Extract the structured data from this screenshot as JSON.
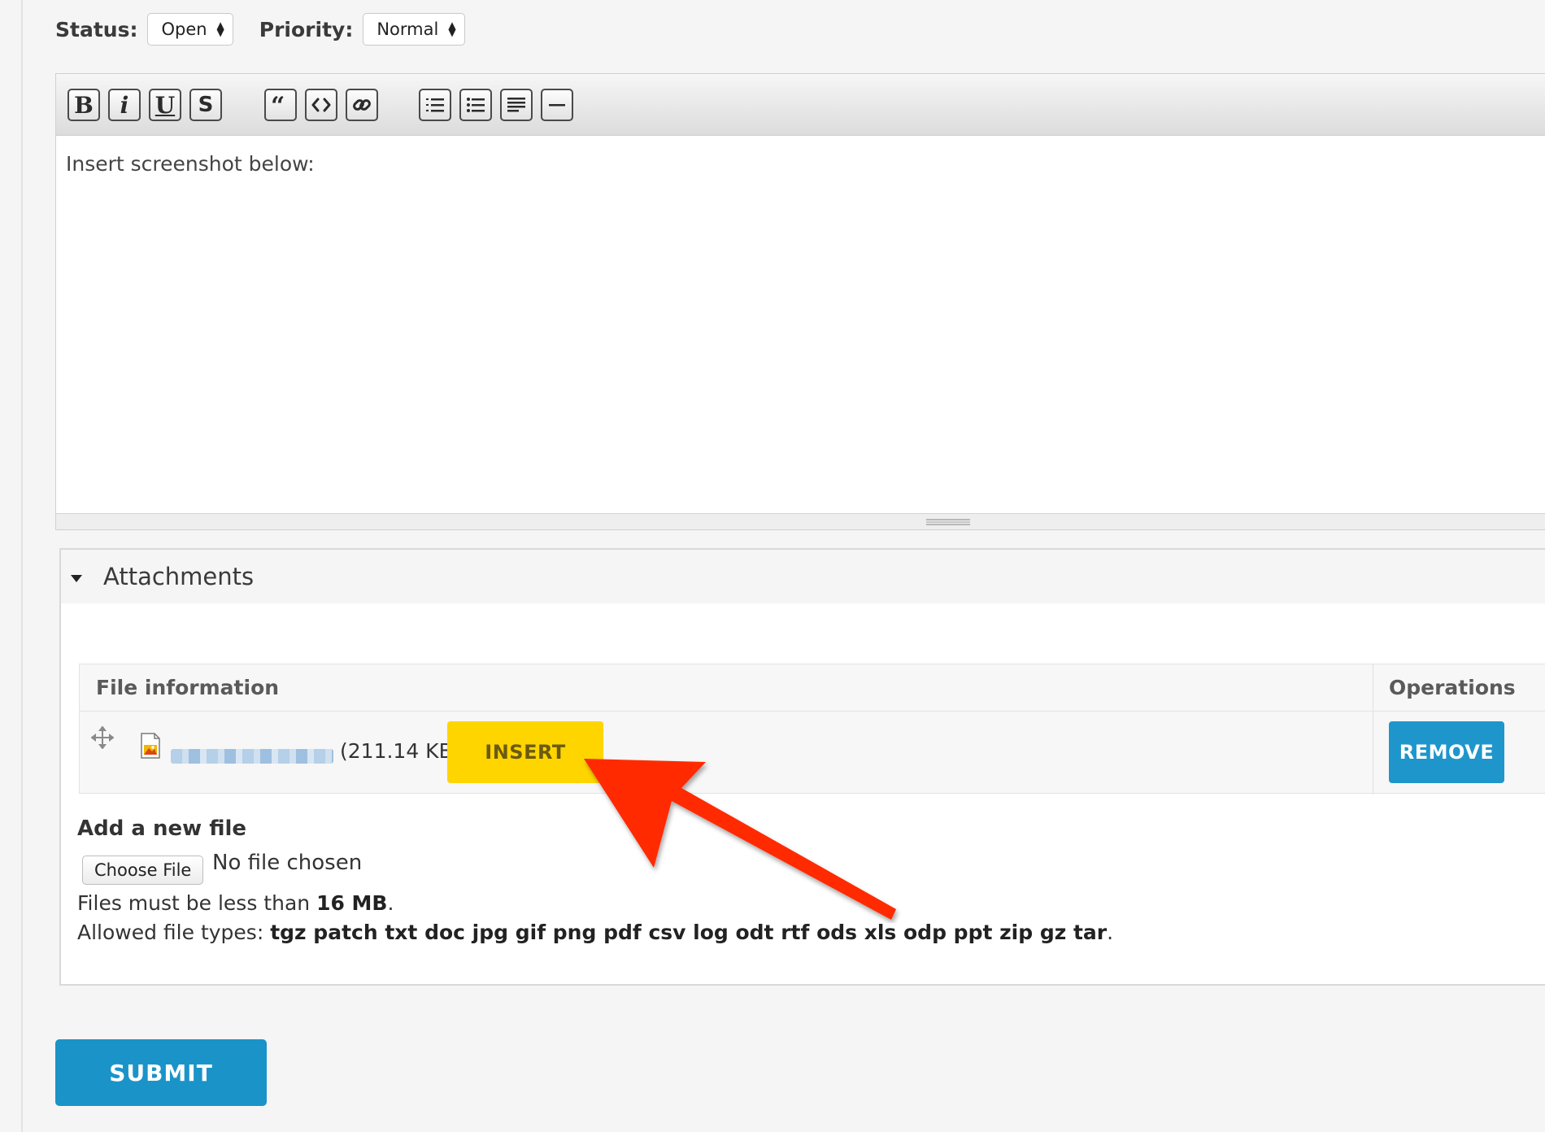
{
  "meta": {
    "status_label": "Status:",
    "status_value": "Open",
    "priority_label": "Priority:",
    "priority_value": "Normal"
  },
  "editor": {
    "toolbar": [
      {
        "name": "bold",
        "glyph": "B"
      },
      {
        "name": "italic",
        "glyph": "i"
      },
      {
        "name": "underline",
        "glyph": "U"
      },
      {
        "name": "strikethrough",
        "glyph": "S"
      },
      {
        "name": "blockquote",
        "icon": "quote-icon"
      },
      {
        "name": "code",
        "icon": "code-icon"
      },
      {
        "name": "link",
        "icon": "link-icon"
      },
      {
        "name": "numbered-list",
        "icon": "ordered-list-icon"
      },
      {
        "name": "bullet-list",
        "icon": "bullet-list-icon"
      },
      {
        "name": "align",
        "icon": "align-left-icon"
      },
      {
        "name": "horizontal-rule",
        "icon": "hr-icon"
      }
    ],
    "content": "Insert screenshot below:"
  },
  "attachments": {
    "title": "Attachments",
    "table": {
      "col_file_info": "File information",
      "col_operations": "Operations",
      "rows": [
        {
          "size": "(211.14 KB)",
          "insert_label": "INSERT",
          "remove_label": "REMOVE"
        }
      ]
    },
    "add_title": "Add a new file",
    "choose_label": "Choose File",
    "no_file": "No file chosen",
    "limit_prefix": "Files must be less than ",
    "limit_value": "16 MB",
    "limit_suffix": ".",
    "types_prefix": "Allowed file types: ",
    "types_value": "tgz patch txt doc jpg gif png pdf csv log odt rtf ods xls odp ppt zip gz tar",
    "types_suffix": "."
  },
  "submit_label": "SUBMIT",
  "colors": {
    "insert": "#ffd500",
    "remove": "#1e96cb",
    "submit": "#1a94c8",
    "annotation_arrow": "#ff2a00"
  }
}
